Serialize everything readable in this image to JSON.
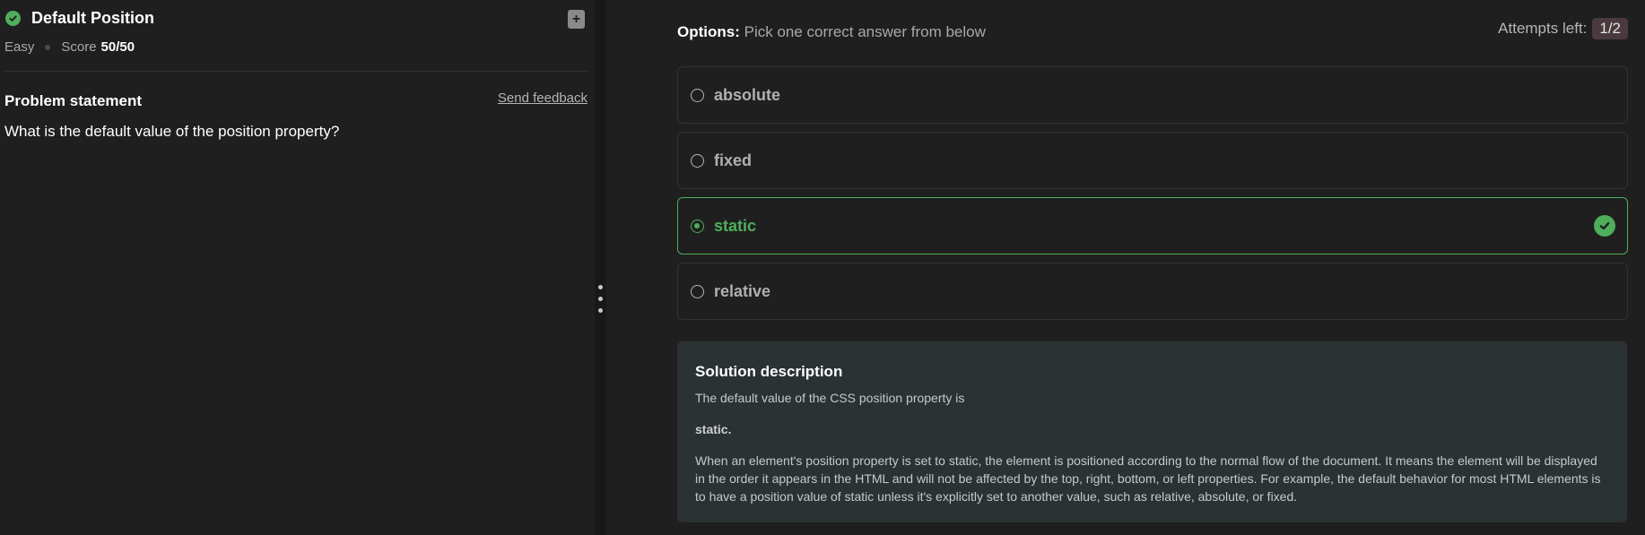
{
  "problem": {
    "title": "Default Position",
    "difficulty": "Easy",
    "score_label": "Score",
    "score_value": "50/50",
    "statement_heading": "Problem statement",
    "send_feedback": "Send feedback",
    "question": "What is the default value of the position property?"
  },
  "options": {
    "label_bold": "Options:",
    "label_rest": "Pick one correct answer from below",
    "attempts_label": "Attempts left:",
    "attempts_value": "1/2",
    "items": [
      {
        "label": "absolute",
        "state": "unselected"
      },
      {
        "label": "fixed",
        "state": "unselected"
      },
      {
        "label": "static",
        "state": "selected-correct"
      },
      {
        "label": "relative",
        "state": "unselected"
      }
    ]
  },
  "solution": {
    "heading": "Solution description",
    "intro": "The default value of the CSS position property is",
    "answer": "static.",
    "body": "When an element's position property is set to static, the element is positioned according to the normal flow of the document. It means the element will be displayed in the order it appears in the HTML and will not be affected by the top, right, bottom, or left properties. For example, the default behavior for most HTML elements is to have a position value of static unless it's explicitly set to another value, such as relative, absolute, or fixed."
  },
  "colors": {
    "background": "#1f1f1f",
    "success": "#4fae5b",
    "solution_bg": "#2a3234",
    "attempts_badge": "#4a3a3d"
  },
  "icons": {
    "solved": "check-circle-icon",
    "bookmark": "bookmark-plus-icon",
    "resize": "vertical-dots-icon",
    "correct": "check-circle-icon"
  }
}
